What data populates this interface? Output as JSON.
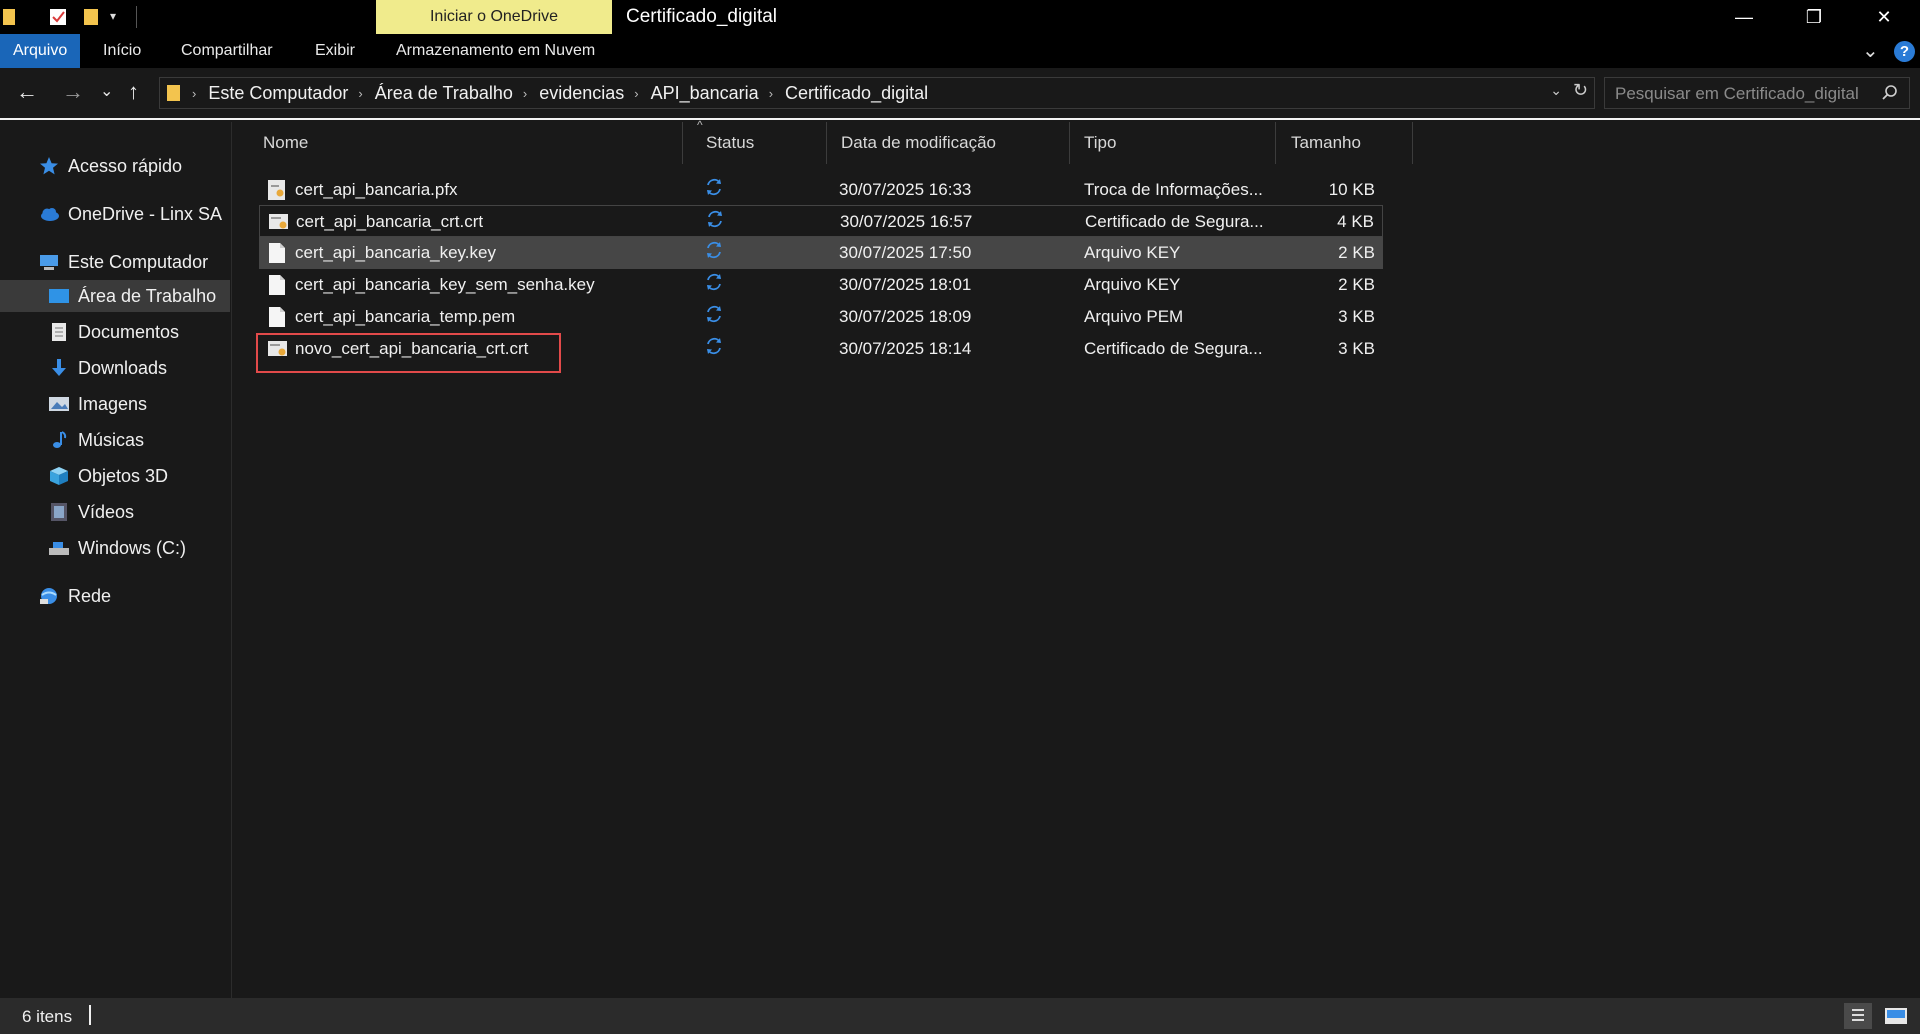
{
  "window": {
    "title": "Certificado_digital",
    "onedrive_banner": "Iniciar o OneDrive",
    "controls": {
      "minimize": "—",
      "restore": "❐",
      "close": "✕"
    }
  },
  "ribbon": {
    "tabs": [
      "Arquivo",
      "Início",
      "Compartilhar",
      "Exibir",
      "Armazenamento em Nuvem"
    ],
    "active_tab": "Arquivo",
    "expand_icon": "⌄",
    "help": "?"
  },
  "nav": {
    "back": "←",
    "forward": "→",
    "recent": "⌄",
    "up": "↑"
  },
  "address": {
    "crumbs": [
      "Este Computador",
      "Área de Trabalho",
      "evidencias",
      "API_bancaria",
      "Certificado_digital"
    ],
    "separator": "›",
    "dropdown_icon": "⌄",
    "refresh_icon": "↻"
  },
  "search": {
    "placeholder": "Pesquisar em Certificado_digital"
  },
  "sidebar": {
    "items": [
      {
        "label": "Acesso rápido",
        "icon": "star-icon"
      },
      {
        "label": "OneDrive - Linx SA",
        "icon": "cloud-icon"
      },
      {
        "label": "Este Computador",
        "icon": "computer-icon"
      },
      {
        "label": "Área de Trabalho",
        "icon": "desktop-icon",
        "selected": true
      },
      {
        "label": "Documentos",
        "icon": "documents-icon"
      },
      {
        "label": "Downloads",
        "icon": "download-icon"
      },
      {
        "label": "Imagens",
        "icon": "pictures-icon"
      },
      {
        "label": "Músicas",
        "icon": "music-icon"
      },
      {
        "label": "Objetos 3D",
        "icon": "cube-icon"
      },
      {
        "label": "Vídeos",
        "icon": "video-icon"
      },
      {
        "label": "Windows (C:)",
        "icon": "drive-icon"
      },
      {
        "label": "Rede",
        "icon": "network-icon"
      }
    ]
  },
  "columns": {
    "name": "Nome",
    "status": "Status",
    "modified": "Data de modificação",
    "type": "Tipo",
    "size": "Tamanho",
    "sort_caret": "^"
  },
  "files": [
    {
      "name": "cert_api_bancaria.pfx",
      "modified": "30/07/2025 16:33",
      "type": "Troca de Informações...",
      "size": "10 KB",
      "icon": "pfx-file-icon"
    },
    {
      "name": "cert_api_bancaria_crt.crt",
      "modified": "30/07/2025 16:57",
      "type": "Certificado de Segura...",
      "size": "4 KB",
      "icon": "certificate-file-icon"
    },
    {
      "name": "cert_api_bancaria_key.key",
      "modified": "30/07/2025 17:50",
      "type": "Arquivo KEY",
      "size": "2 KB",
      "icon": "blank-file-icon"
    },
    {
      "name": "cert_api_bancaria_key_sem_senha.key",
      "modified": "30/07/2025 18:01",
      "type": "Arquivo KEY",
      "size": "2 KB",
      "icon": "blank-file-icon"
    },
    {
      "name": "cert_api_bancaria_temp.pem",
      "modified": "30/07/2025 18:09",
      "type": "Arquivo PEM",
      "size": "3 KB",
      "icon": "blank-file-icon"
    },
    {
      "name": "novo_cert_api_bancaria_crt.crt",
      "modified": "30/07/2025 18:14",
      "type": "Certificado de Segura...",
      "size": "3 KB",
      "icon": "certificate-file-icon"
    }
  ],
  "status_bar": {
    "item_count": "6 itens"
  },
  "colors": {
    "accent": "#1a66b8",
    "banner": "#f0eb8c",
    "sync": "#3a8ee6",
    "highlight_box": "#e24a4a"
  }
}
